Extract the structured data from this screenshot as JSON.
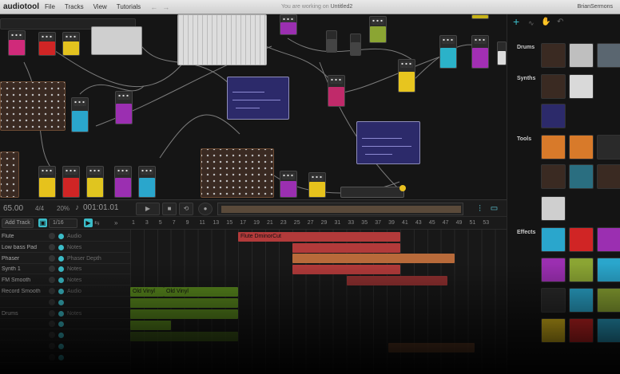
{
  "app": {
    "logo": "audiotool",
    "menu": [
      "File",
      "Tracks",
      "View",
      "Tutorials"
    ],
    "nav_back": "←",
    "nav_forward": "→",
    "doc_status_prefix": "You are working on",
    "doc_name": "Untitled2",
    "user_name": "BrianSermons"
  },
  "transport": {
    "tempo": "65.00",
    "signature": "4/4",
    "swing": "20%",
    "note_icon": "♪",
    "position": "001:01.01",
    "play_label": "▶",
    "stop_label": "■",
    "loop_label": "⟲",
    "record_label": "●"
  },
  "tracks_header": {
    "add_track": "Add Track",
    "grid": "1/16",
    "ruler": [
      "1",
      "3",
      "5",
      "7",
      "9",
      "11",
      "13",
      "15",
      "17",
      "19",
      "21",
      "23",
      "25",
      "27",
      "29",
      "31",
      "33",
      "35",
      "37",
      "39",
      "41",
      "43",
      "45",
      "47",
      "49",
      "51",
      "53"
    ]
  },
  "tracks": [
    {
      "name": "Flute",
      "device": "Audio"
    },
    {
      "name": "Low bass Pad",
      "device": "Notes"
    },
    {
      "name": "Phaser",
      "device": "Phaser Depth"
    },
    {
      "name": "Synth 1",
      "device": "Notes"
    },
    {
      "name": "FM Smooth",
      "device": "Notes"
    },
    {
      "name": "Record Smooth",
      "device": "Audio"
    },
    {
      "name": "",
      "device": ""
    },
    {
      "name": "Drums",
      "device": "Notes"
    },
    {
      "name": "",
      "device": ""
    },
    {
      "name": "",
      "device": ""
    },
    {
      "name": "",
      "device": ""
    },
    {
      "name": "",
      "device": ""
    }
  ],
  "clips": [
    {
      "label": "Flute DminorCut",
      "color": "red"
    },
    {
      "label": "",
      "color": "red"
    },
    {
      "label": "",
      "color": "orange"
    },
    {
      "label": "",
      "color": "red"
    },
    {
      "label": "",
      "color": "darkred"
    },
    {
      "label": "Old Vinyl",
      "color": "green"
    },
    {
      "label": "Old Vinyl",
      "color": "green"
    },
    {
      "label": "",
      "color": "green"
    },
    {
      "label": "",
      "color": "green"
    },
    {
      "label": "",
      "color": "green"
    }
  ],
  "browser": {
    "tabs": [
      "add-icon",
      "waveform-icon",
      "hand-cursor-icon",
      "undo-icon"
    ],
    "categories": [
      {
        "label": "Drums"
      },
      {
        "label": "Synths"
      },
      {
        "label": "Tools"
      },
      {
        "label": "Effects"
      }
    ]
  },
  "colors": {
    "accent": "#3bbcc8",
    "clip_red": "#b23a3a",
    "clip_orange": "#b86a3a",
    "clip_green": "#5a8a1e"
  }
}
